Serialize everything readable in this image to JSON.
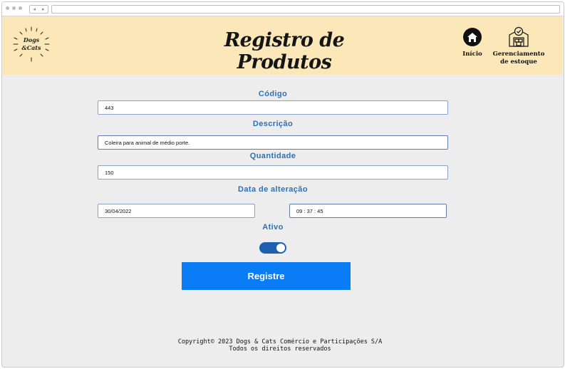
{
  "header": {
    "title": "Registro de Produtos",
    "logo_line1": "Dogs",
    "logo_line2": "&Cats",
    "nav": {
      "home_label": "Início",
      "stock_label_line1": "Gerenciamento",
      "stock_label_line2": "de estoque"
    }
  },
  "form": {
    "codigo": {
      "label": "Código",
      "value": "443"
    },
    "descricao": {
      "label": "Descrição",
      "value": "Coleira para animal de médio porte."
    },
    "quantidade": {
      "label": "Quantidade",
      "value": "150"
    },
    "data_alteracao": {
      "label": "Data de alteração",
      "date_value": "30/04/2022",
      "time_value": "09 : 37 : 45"
    },
    "ativo": {
      "label": "Ativo",
      "on": true
    },
    "submit_label": "Registre"
  },
  "footer": {
    "line1": "Copyright© 2023 Dogs & Cats Comércio e Participações S/A",
    "line2": "Todos os direitos reservados"
  },
  "colors": {
    "header_bg": "#fbe7b8",
    "label_blue": "#2f6fb6",
    "button_blue": "#0a7cf5",
    "toggle_on": "#1e5fb0",
    "page_bg": "#ededed"
  }
}
